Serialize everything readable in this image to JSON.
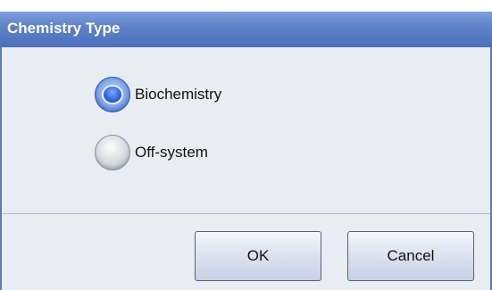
{
  "dialog": {
    "title": "Chemistry Type",
    "options": [
      {
        "label": "Biochemistry",
        "selected": true
      },
      {
        "label": "Off-system",
        "selected": false
      }
    ],
    "buttons": {
      "ok_label": "OK",
      "cancel_label": "Cancel"
    }
  },
  "colors": {
    "titlebar": "#5d80c8",
    "body": "#eaecf4",
    "border": "#5a7bbf",
    "radio_selected": "#2c63d6"
  }
}
